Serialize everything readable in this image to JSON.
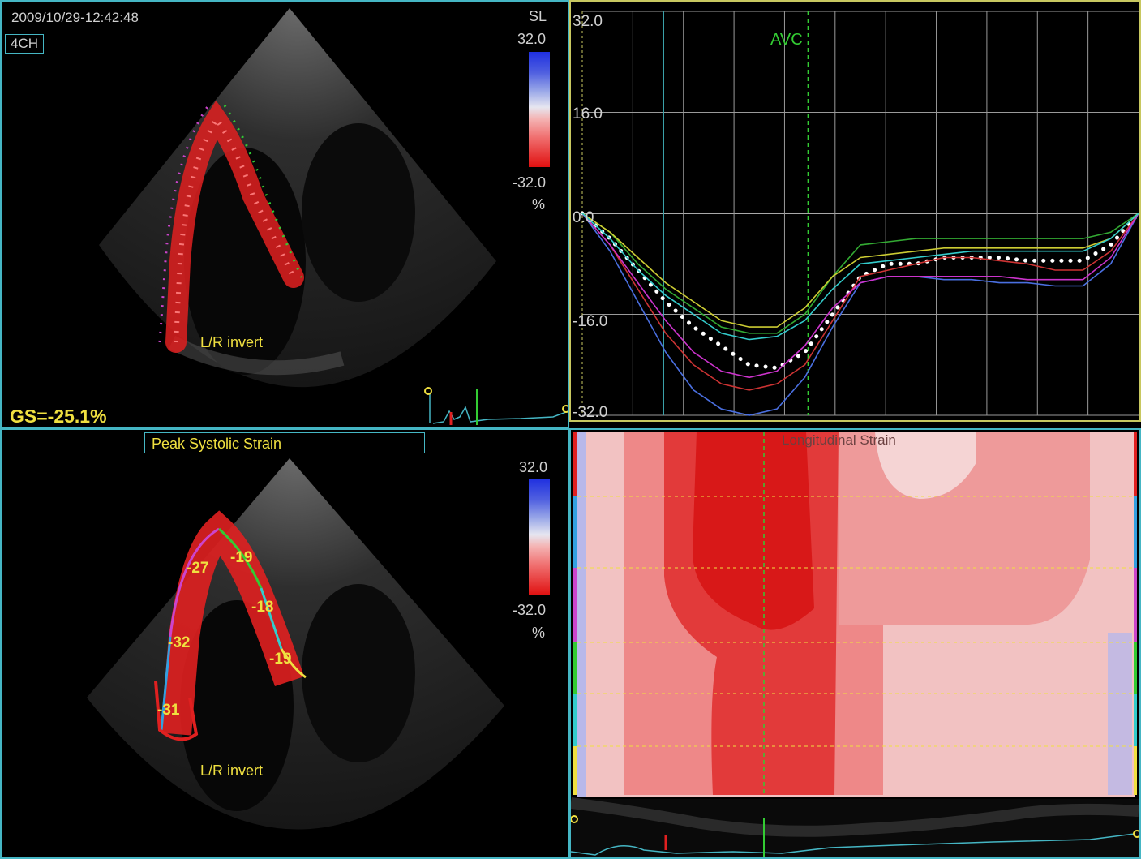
{
  "top_left": {
    "timestamp": "2009/10/29-12:42:48",
    "view": "4CH",
    "scale_label": "SL",
    "scale_max": "32.0",
    "scale_min": "-32.0",
    "unit": "%",
    "invert_note": "L/R invert",
    "gs_text": "GS=-25.1%"
  },
  "bottom_left": {
    "title": "Peak Systolic Strain",
    "scale_max": "32.0",
    "scale_min": "-32.0",
    "unit": "%",
    "invert_note": "L/R invert",
    "segment_values": [
      "-27",
      "-19",
      "-18",
      "-32",
      "-19",
      "-31"
    ]
  },
  "chart_data": {
    "type": "line",
    "title": "",
    "xlabel": "",
    "ylabel": "",
    "ylim": [
      -32,
      32
    ],
    "yticks": [
      "32.0",
      "16.0",
      "0.0",
      "-16.0",
      "-32.0"
    ],
    "marker": "AVC",
    "x": [
      0,
      5,
      10,
      15,
      20,
      25,
      30,
      35,
      40,
      45,
      50,
      55,
      60,
      65,
      70,
      75,
      80,
      85,
      90,
      95,
      100
    ],
    "series": [
      {
        "color": "#ffffff",
        "style": "dotted",
        "values": [
          0,
          -4,
          -9,
          -14,
          -18,
          -21,
          -24,
          -24.5,
          -22,
          -16,
          -10,
          -8,
          -8,
          -7,
          -7,
          -7,
          -7.5,
          -7.5,
          -7.5,
          -5,
          0
        ]
      },
      {
        "color": "#4a6fe0",
        "values": [
          0,
          -6,
          -14,
          -22,
          -28,
          -31,
          -32,
          -31,
          -26,
          -18,
          -11,
          -10,
          -10,
          -10.5,
          -10.5,
          -11,
          -11,
          -11.5,
          -11.5,
          -8,
          0
        ]
      },
      {
        "color": "#cc3333",
        "values": [
          0,
          -5,
          -12,
          -19,
          -24,
          -27,
          -28,
          -27,
          -24,
          -17,
          -10,
          -9,
          -8,
          -7,
          -7,
          -7.5,
          -8,
          -9,
          -9,
          -6,
          0
        ]
      },
      {
        "color": "#cc33cc",
        "values": [
          0,
          -5,
          -11,
          -17,
          -22,
          -25,
          -26,
          -25,
          -21,
          -15,
          -11,
          -10,
          -10,
          -10,
          -10,
          -10,
          -10.5,
          -10.5,
          -10.5,
          -7,
          0
        ]
      },
      {
        "color": "#33aa33",
        "values": [
          0,
          -3,
          -8,
          -12,
          -15,
          -18,
          -19,
          -19,
          -16,
          -10,
          -5,
          -4.5,
          -4,
          -4,
          -4,
          -4,
          -4,
          -4,
          -4,
          -3,
          0
        ]
      },
      {
        "color": "#cccc33",
        "values": [
          0,
          -3,
          -7,
          -11,
          -14,
          -17,
          -18,
          -18,
          -15,
          -10,
          -7,
          -6.5,
          -6,
          -5.5,
          -5.5,
          -5.5,
          -5.5,
          -5.5,
          -5.5,
          -4,
          0
        ]
      },
      {
        "color": "#33cccc",
        "values": [
          0,
          -4,
          -9,
          -13,
          -16,
          -19,
          -20,
          -19.5,
          -17,
          -12,
          -8,
          -7.5,
          -7,
          -6.5,
          -6,
          -6,
          -6,
          -6,
          -6,
          -4,
          0
        ]
      }
    ]
  },
  "heatmap": {
    "title": "Longitudinal Strain"
  },
  "colors": {
    "frame": "#45b6c4",
    "label_yellow": "#f0e040",
    "avc_green": "#33cc33",
    "strain_red": "#e02020",
    "strain_pink": "#f4bcbc"
  }
}
